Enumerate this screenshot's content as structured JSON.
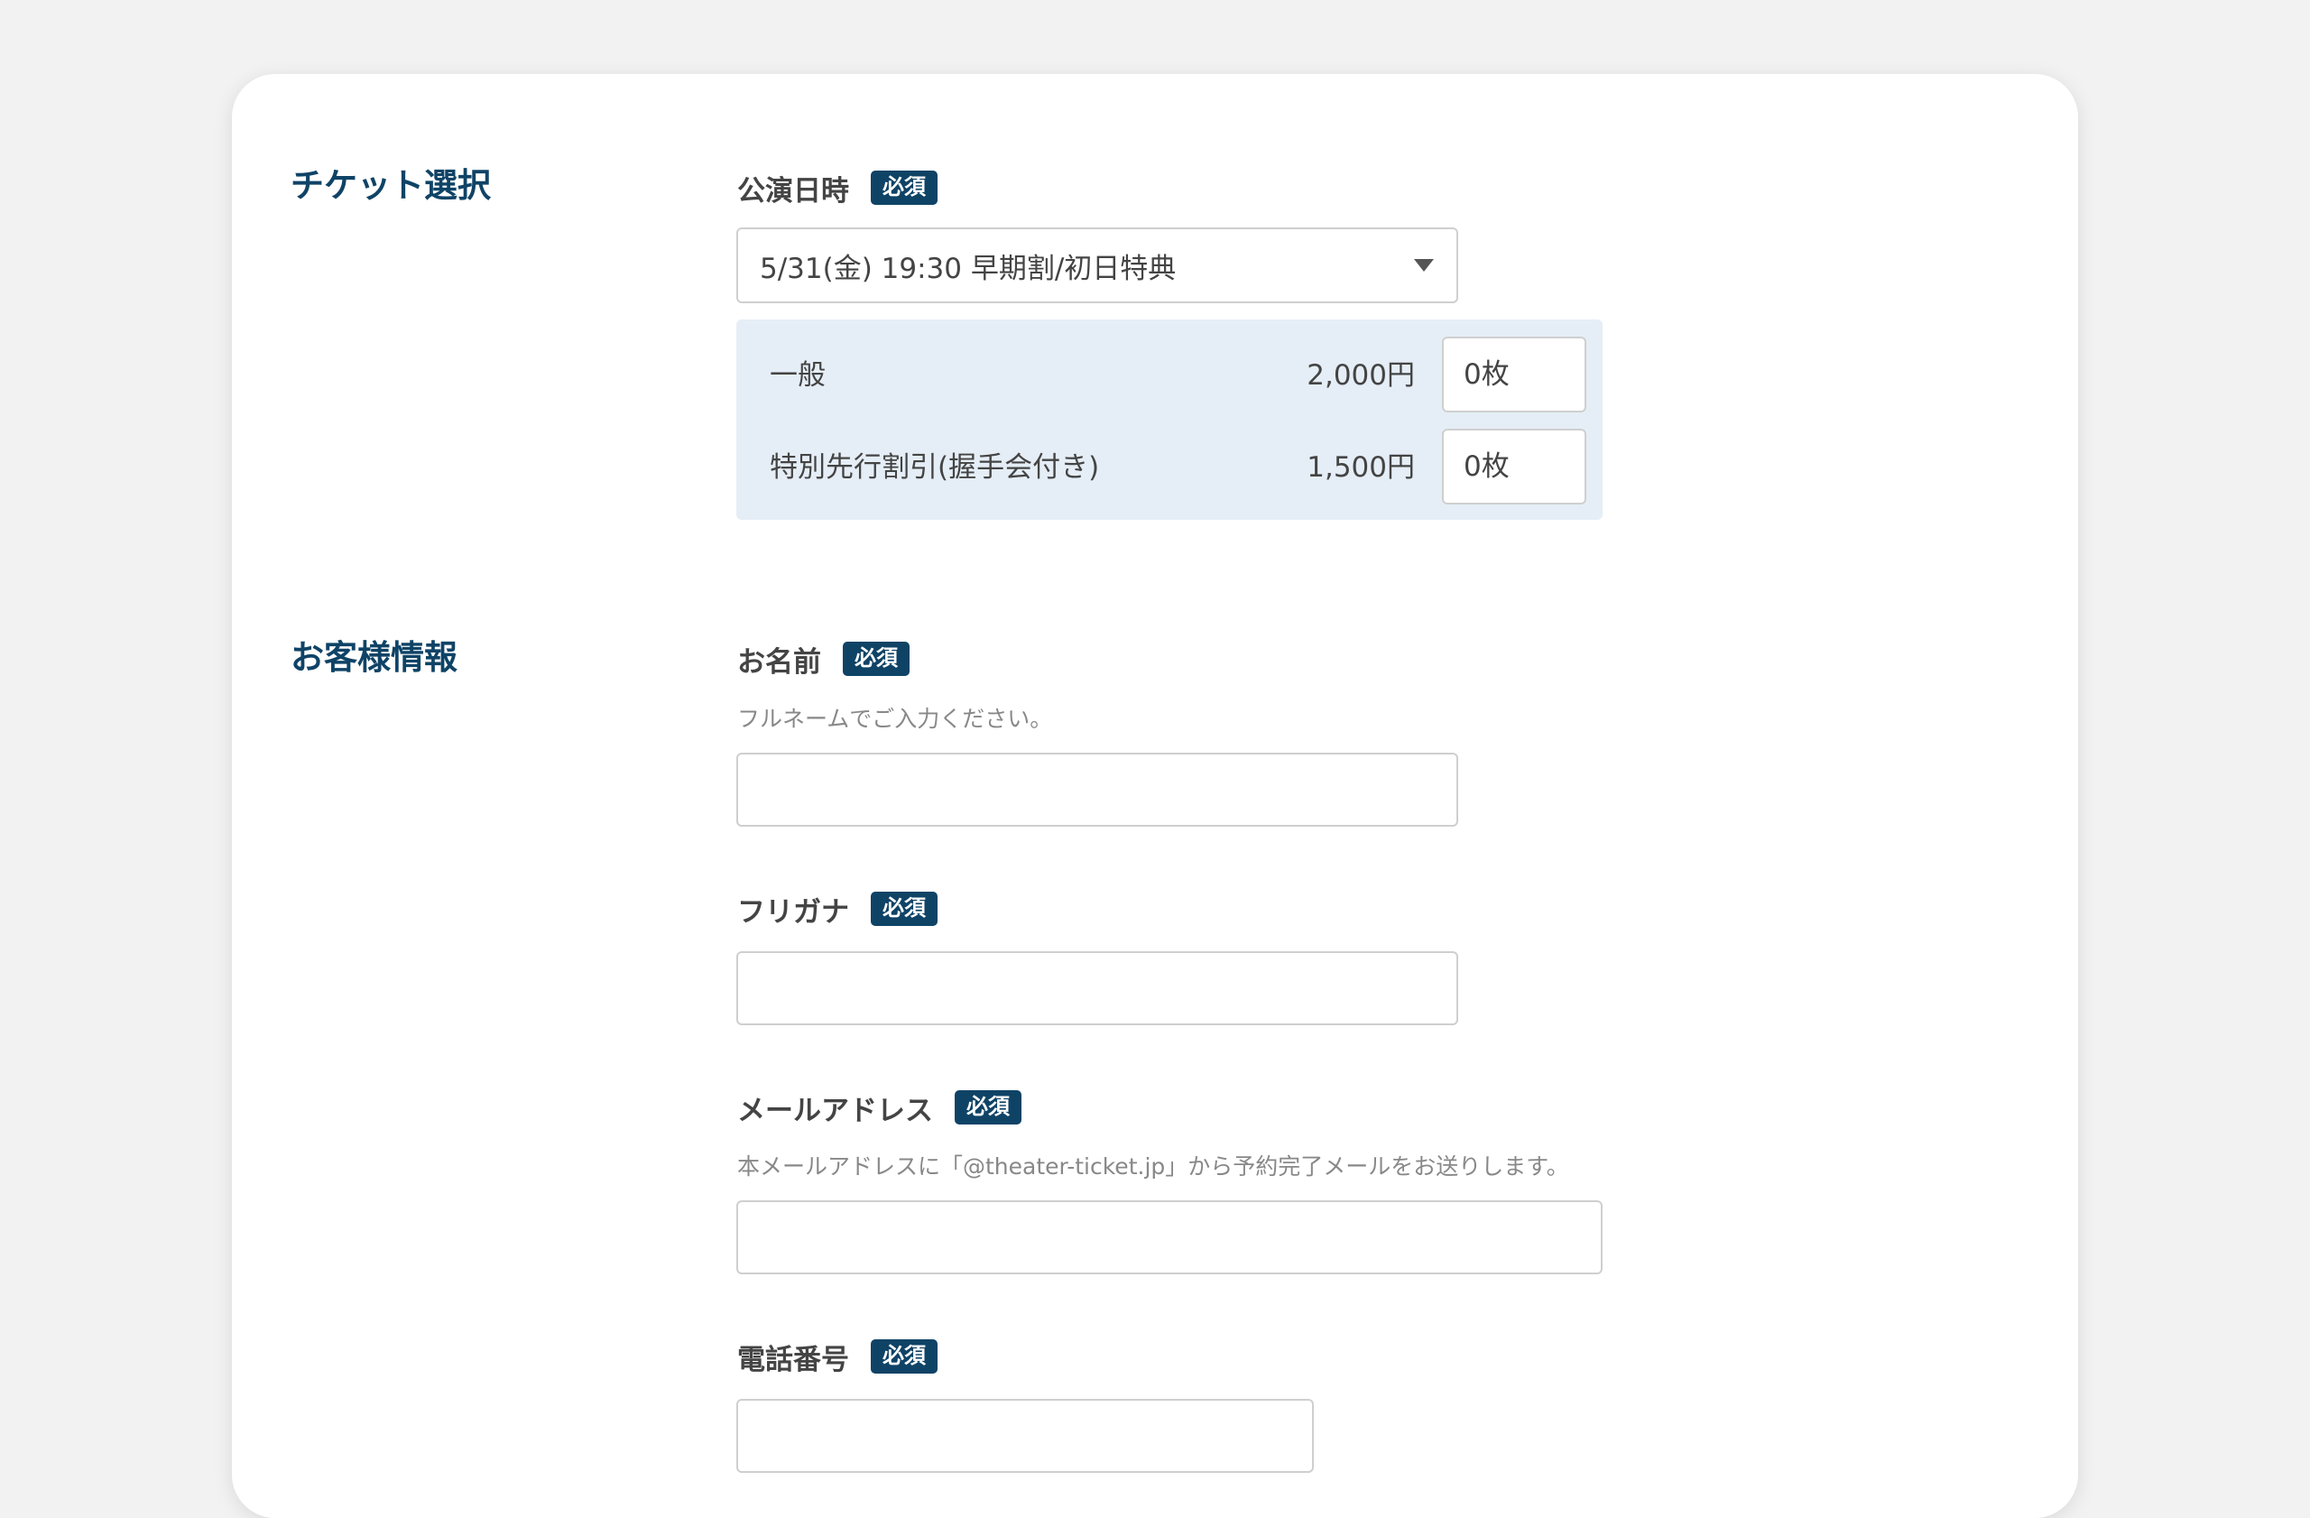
{
  "ticket_section": {
    "title": "チケット選択",
    "performance_label": "公演日時",
    "required_badge": "必須",
    "selected_performance": "5/31(金) 19:30 早期割/初日特典",
    "tickets": [
      {
        "name": "一般",
        "price": "2,000円",
        "quantity": "0枚"
      },
      {
        "name": "特別先行割引(握手会付き)",
        "price": "1,500円",
        "quantity": "0枚"
      }
    ]
  },
  "customer_section": {
    "title": "お客様情報",
    "name_label": "お名前",
    "name_help": "フルネームでご入力ください。",
    "kana_label": "フリガナ",
    "email_label": "メールアドレス",
    "email_help": "本メールアドレスに「@theater-ticket.jp」から予約完了メールをお送りします。",
    "phone_label": "電話番号",
    "required_badge": "必須"
  }
}
